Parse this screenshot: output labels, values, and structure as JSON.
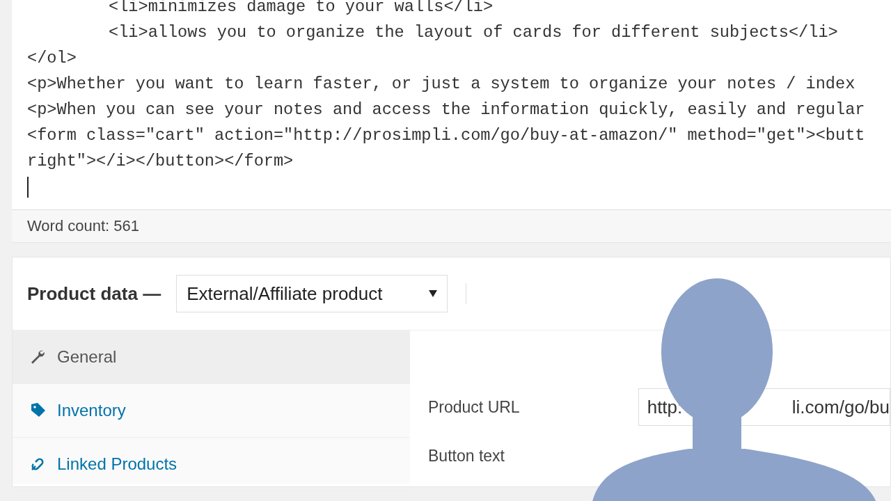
{
  "editor": {
    "lines": [
      {
        "kind": "nested",
        "text": "<li>minimizes damage to your walls</li>"
      },
      {
        "kind": "nested",
        "text": "<li>allows you to organize the layout of cards for different subjects</li>"
      },
      {
        "kind": "top",
        "text": "</ol>"
      },
      {
        "kind": "top",
        "text": "<p>Whether you want to learn faster, or just a system to organize your notes / index"
      },
      {
        "kind": "top",
        "text": "<p>When you can see your notes and access the information quickly, easily and regular"
      },
      {
        "kind": "top",
        "text": "<form class=\"cart\" action=\"http://prosimpli.com/go/buy-at-amazon/\" method=\"get\"><butt"
      },
      {
        "kind": "top",
        "text": "right\"></i></button></form>"
      }
    ],
    "word_count": "Word count: 561"
  },
  "product_data": {
    "title": "Product data —",
    "type_select": "External/Affiliate product",
    "tabs": [
      {
        "label": "General",
        "kind": "wrench",
        "selected": true
      },
      {
        "label": "Inventory",
        "kind": "tag",
        "selected": false
      },
      {
        "label": "Linked Products",
        "kind": "link",
        "selected": false
      }
    ],
    "fields": [
      {
        "label": "Product URL",
        "value_start": "http:",
        "value_end": "li.com/go/bu"
      },
      {
        "label": "Button text"
      }
    ]
  }
}
